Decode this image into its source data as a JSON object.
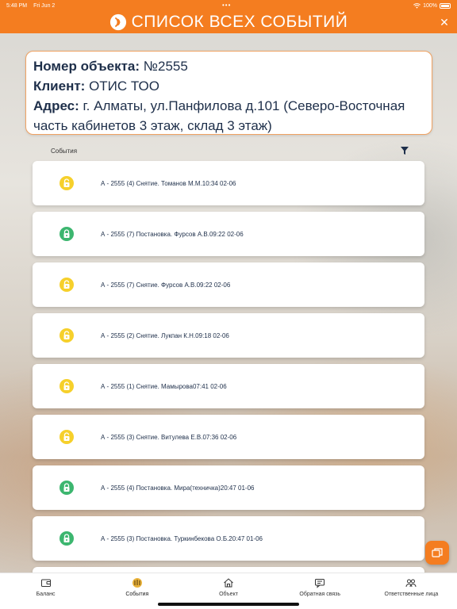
{
  "status_bar": {
    "time": "5:48 PM",
    "date": "Fri Jun 2",
    "battery": "100%"
  },
  "header": {
    "title": "СПИСОК ВСЕХ СОБЫТИЙ",
    "close": "✕"
  },
  "object_info": {
    "number_label": "Номер объекта:",
    "number_value": "№2555",
    "client_label": "Клиент:",
    "client_value": "ОТИС ТОО",
    "address_label": "Адрес:",
    "address_value": "г. Алматы, ул.Панфилова д.101 (Северо-Восточная часть кабинетов 3 этаж, склад 3 этаж)"
  },
  "list": {
    "header": "События"
  },
  "events": [
    {
      "text": "А - 2555 (4) Снятие. Томанов М.М.10:34 02-06",
      "status": "yellow"
    },
    {
      "text": "А - 2555 (7) Постановка. Фурсов А.В.09:22 02-06",
      "status": "green"
    },
    {
      "text": "А - 2555 (7) Снятие. Фурсов А.В.09:22 02-06",
      "status": "yellow"
    },
    {
      "text": "А - 2555 (2) Снятие. Лукпан К.Н.09:18 02-06",
      "status": "yellow"
    },
    {
      "text": "А - 2555 (1) Снятие. Мамырова07:41 02-06",
      "status": "yellow"
    },
    {
      "text": "А - 2555 (3) Снятие. Витулева Е.В.07:36 02-06",
      "status": "yellow"
    },
    {
      "text": "А - 2555 (4) Постановка. Мира(техничка)20:47 01-06",
      "status": "green"
    },
    {
      "text": "А - 2555 (3) Постановка. Туркинбекова О.Б.20:47 01-06",
      "status": "green"
    },
    {
      "text": "",
      "status": "none"
    }
  ],
  "colors": {
    "accent": "#f47d20",
    "lock_yellow": "#f6d02b",
    "lock_green": "#3cb66f",
    "text_dark": "#1e2f4a"
  },
  "tabs": [
    {
      "label": "Баланс",
      "icon": "wallet-icon",
      "active": false
    },
    {
      "label": "События",
      "icon": "events-icon",
      "active": true
    },
    {
      "label": "Объект",
      "icon": "home-icon",
      "active": false
    },
    {
      "label": "Обратная связь",
      "icon": "feedback-icon",
      "active": false
    },
    {
      "label": "Ответственные лица",
      "icon": "people-icon",
      "active": false
    }
  ]
}
